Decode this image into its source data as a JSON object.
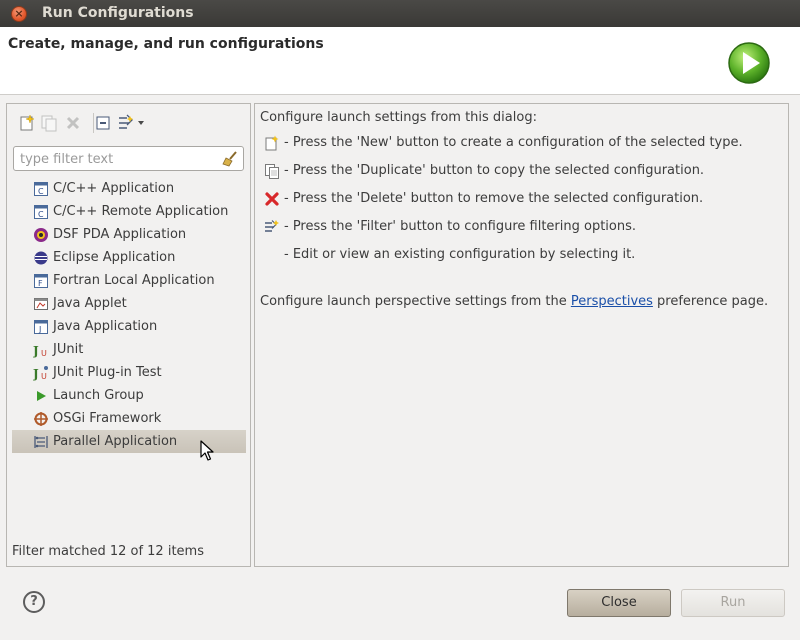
{
  "window": {
    "title": "Run Configurations"
  },
  "banner": {
    "title": "Create, manage, and run configurations",
    "icon": "run-icon"
  },
  "colors": {
    "selection": "#cdc7bc",
    "link": "#1a4fa8",
    "titlebar": "#3c3b37",
    "close_button": "#e05a2b"
  },
  "toolbar": {
    "buttons": [
      {
        "name": "new-configuration-icon",
        "enabled": true
      },
      {
        "name": "duplicate-icon",
        "enabled": false
      },
      {
        "name": "delete-icon",
        "enabled": false
      },
      {
        "name": "collapse-all-icon",
        "enabled": true
      },
      {
        "name": "filter-icon",
        "enabled": true
      }
    ]
  },
  "filter": {
    "placeholder": "type filter text",
    "value": ""
  },
  "tree": {
    "items": [
      {
        "label": "C/C++ Application",
        "icon": "cpp-app-icon"
      },
      {
        "label": "C/C++ Remote Application",
        "icon": "cpp-remote-icon"
      },
      {
        "label": "DSF PDA Application",
        "icon": "dsf-pda-icon"
      },
      {
        "label": "Eclipse Application",
        "icon": "eclipse-icon"
      },
      {
        "label": "Fortran Local Application",
        "icon": "fortran-icon"
      },
      {
        "label": "Java Applet",
        "icon": "java-applet-icon"
      },
      {
        "label": "Java Application",
        "icon": "java-app-icon"
      },
      {
        "label": "JUnit",
        "icon": "junit-icon"
      },
      {
        "label": "JUnit Plug-in Test",
        "icon": "junit-plugin-icon"
      },
      {
        "label": "Launch Group",
        "icon": "launch-group-icon"
      },
      {
        "label": "OSGi Framework",
        "icon": "osgi-icon"
      },
      {
        "label": "Parallel Application",
        "icon": "parallel-app-icon",
        "selected": true
      }
    ]
  },
  "filter_status": "Filter matched 12 of 12 items",
  "help": {
    "intro": "Configure launch settings from this dialog:",
    "lines": [
      {
        "icon": "new-configuration-icon",
        "text": "- Press the 'New' button to create a configuration of the selected type."
      },
      {
        "icon": "duplicate-icon",
        "text": "- Press the 'Duplicate' button to copy the selected configuration."
      },
      {
        "icon": "delete-icon",
        "text": "- Press the 'Delete' button to remove the selected configuration."
      },
      {
        "icon": "filter-icon",
        "text": "- Press the 'Filter' button to configure filtering options."
      },
      {
        "icon": "",
        "text": "- Edit or view an existing configuration by selecting it."
      }
    ],
    "perspective_prefix": "Configure launch perspective settings from the ",
    "perspective_link": "Perspectives",
    "perspective_suffix": " preference page."
  },
  "buttons": {
    "close": "Close",
    "run": "Run",
    "run_enabled": false
  }
}
